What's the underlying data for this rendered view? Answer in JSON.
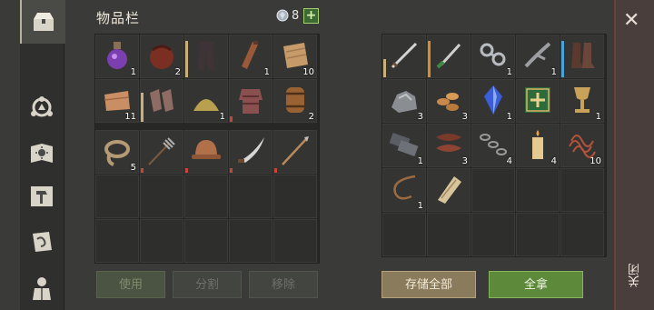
{
  "header": {
    "title": "物品栏",
    "gem_count": "8",
    "plus_label": "+"
  },
  "tabs": [
    {
      "icon": "chest-icon",
      "active": true
    },
    {
      "icon": "crafting-icon",
      "active": false
    },
    {
      "icon": "sun-book-icon",
      "active": false
    },
    {
      "icon": "hammer-icon",
      "active": false
    },
    {
      "icon": "scroll-icon",
      "active": false
    },
    {
      "icon": "character-icon",
      "active": false
    }
  ],
  "inventory": {
    "slots": [
      {
        "item": "potion-icon",
        "qty": "1"
      },
      {
        "item": "leather-bag-icon",
        "qty": "2"
      },
      {
        "item": "pants-icon",
        "qty": ""
      },
      {
        "item": "flask-icon",
        "qty": "1"
      },
      {
        "item": "cloth-icon",
        "qty": "10"
      },
      {
        "item": "cloth-roll-icon",
        "qty": "11"
      },
      {
        "item": "gloves-icon",
        "qty": ""
      },
      {
        "item": "powder-pile-icon",
        "qty": "1"
      },
      {
        "item": "leather-armor-icon",
        "qty": ""
      },
      {
        "item": "barrel-icon",
        "qty": "2"
      },
      {
        "item": "rope-icon",
        "qty": "5"
      },
      {
        "item": "pitchfork-icon",
        "qty": ""
      },
      {
        "item": "helmet-icon",
        "qty": ""
      },
      {
        "item": "scimitar-icon",
        "qty": ""
      },
      {
        "item": "spear-icon",
        "qty": ""
      }
    ],
    "empty_slots": 10
  },
  "storage": {
    "slots": [
      {
        "item": "sword-icon",
        "qty": ""
      },
      {
        "item": "dagger-icon",
        "qty": ""
      },
      {
        "item": "chain-icon",
        "qty": "1"
      },
      {
        "item": "branch-icon",
        "qty": "1"
      },
      {
        "item": "boots-icon",
        "qty": ""
      },
      {
        "item": "ore-icon",
        "qty": "3"
      },
      {
        "item": "grain-icon",
        "qty": "3"
      },
      {
        "item": "crystal-icon",
        "qty": "1"
      },
      {
        "item": "green-book-icon",
        "qty": ""
      },
      {
        "item": "goblet-icon",
        "qty": "1"
      },
      {
        "item": "metal-bars-icon",
        "qty": "1"
      },
      {
        "item": "leather-strips-icon",
        "qty": "3"
      },
      {
        "item": "chain-links-icon",
        "qty": "4"
      },
      {
        "item": "candle-icon",
        "qty": "4"
      },
      {
        "item": "wire-coil-icon",
        "qty": "10"
      },
      {
        "item": "whip-icon",
        "qty": "1"
      },
      {
        "item": "scroll-bundle-icon",
        "qty": ""
      }
    ],
    "empty_slots": 13
  },
  "buttons": {
    "use": "使用",
    "split": "分割",
    "remove": "移除",
    "store_all": "存储全部",
    "take_all": "全拿"
  },
  "close_panel": {
    "label": "关闭"
  },
  "colors": {
    "accent_orange": "#d98a2a",
    "accent_tan": "#c9b07a",
    "accent_blue": "#4aa3d8",
    "accent_red": "#c8443a",
    "take_green": "#5d8a3a"
  }
}
